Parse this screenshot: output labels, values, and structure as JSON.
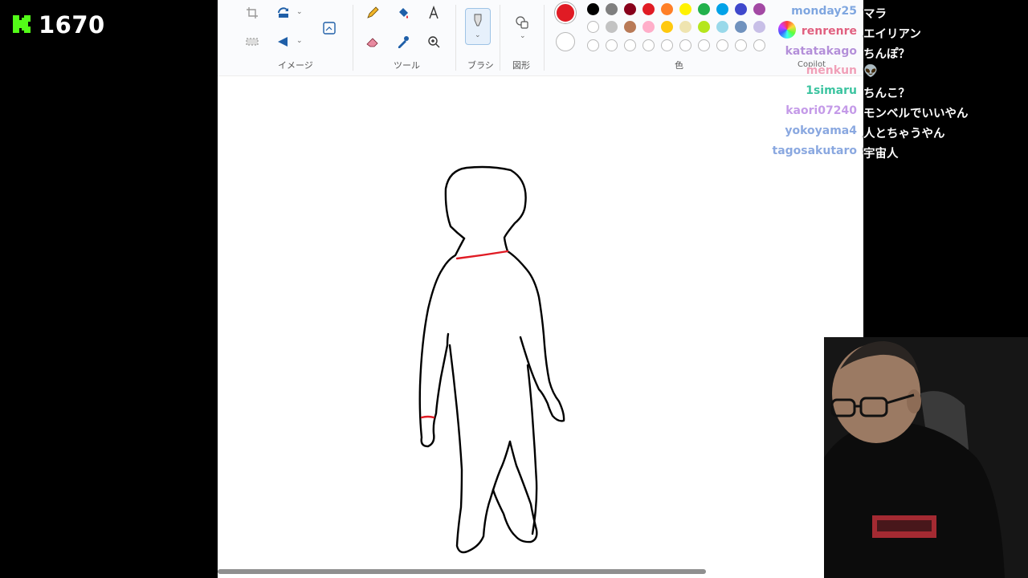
{
  "viewer": {
    "count": "1670"
  },
  "ribbon": {
    "groups": {
      "image": "イメージ",
      "tools": "ツール",
      "brush": "ブラシ",
      "shapes": "図形",
      "colors": "色"
    },
    "copilot": "Copilot"
  },
  "palette": {
    "active_color": "#e01b24",
    "row1": [
      "#000000",
      "#7f7f7f",
      "#88001b",
      "#e01b24",
      "#ff7f27",
      "#fff200",
      "#22b14c",
      "#00a2e8",
      "#3f48cc",
      "#a349a4"
    ],
    "row2": [
      "#ffffff",
      "#c3c3c3",
      "#b97a57",
      "#ffaec9",
      "#ffc90e",
      "#efe4b0",
      "#b5e61d",
      "#99d9ea",
      "#7092be",
      "#c8bfe7"
    ]
  },
  "chat": [
    {
      "user": "monday25",
      "color": "#7fa6e0",
      "message": "マラ"
    },
    {
      "user": "renrenre",
      "color": "#e06080",
      "message": "エイリアン"
    },
    {
      "user": "katatakago",
      "color": "#b38fd9",
      "message": "ちんぽ？"
    },
    {
      "user": "menkun",
      "color": "#f0a0b8",
      "message": "👽"
    },
    {
      "user": "1simaru",
      "color": "#3cc4a0",
      "message": "ちんこ？"
    },
    {
      "user": "kaori07240",
      "color": "#c49ae8",
      "message": "モンベルでいいやん"
    },
    {
      "user": "yokoyama4",
      "color": "#8aa8e0",
      "message": "人とちゃうやん"
    },
    {
      "user": "tagosakutaro",
      "color": "#8aa8e0",
      "message": "宇宙人"
    }
  ]
}
